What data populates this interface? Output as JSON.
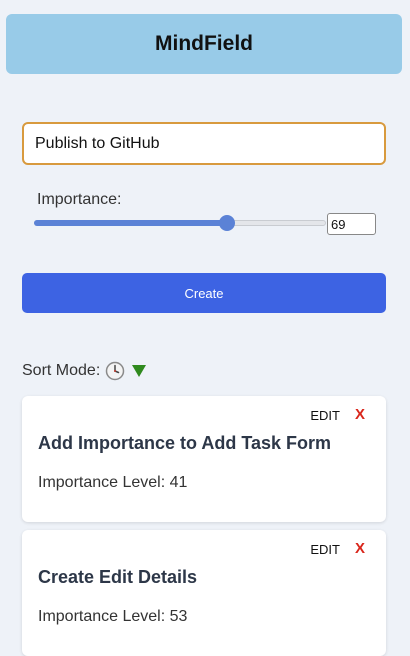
{
  "header": {
    "title": "MindField"
  },
  "form": {
    "task_value": "Publish to GitHub",
    "importance_label": "Importance:",
    "importance_value": "69",
    "importance_fraction": 0.69,
    "create_label": "Create"
  },
  "sort": {
    "label": "Sort Mode:",
    "mode_icon": "clock-icon",
    "direction_icon": "triangle-down-icon"
  },
  "tasks": [
    {
      "title": "Add Importance to Add Task Form",
      "importance": "Importance Level: 41",
      "edit_label": "EDIT",
      "delete_label": "X"
    },
    {
      "title": "Create Edit Details",
      "importance": "Importance Level: 53",
      "edit_label": "EDIT",
      "delete_label": "X"
    }
  ],
  "colors": {
    "header_bg": "#98cbe8",
    "input_focus_border": "#d89a3e",
    "accent_blue": "#3d63e3",
    "slider_blue": "#5b82d6",
    "delete_red": "#d9261b",
    "sort_arrow_green": "#2f8a1e"
  }
}
